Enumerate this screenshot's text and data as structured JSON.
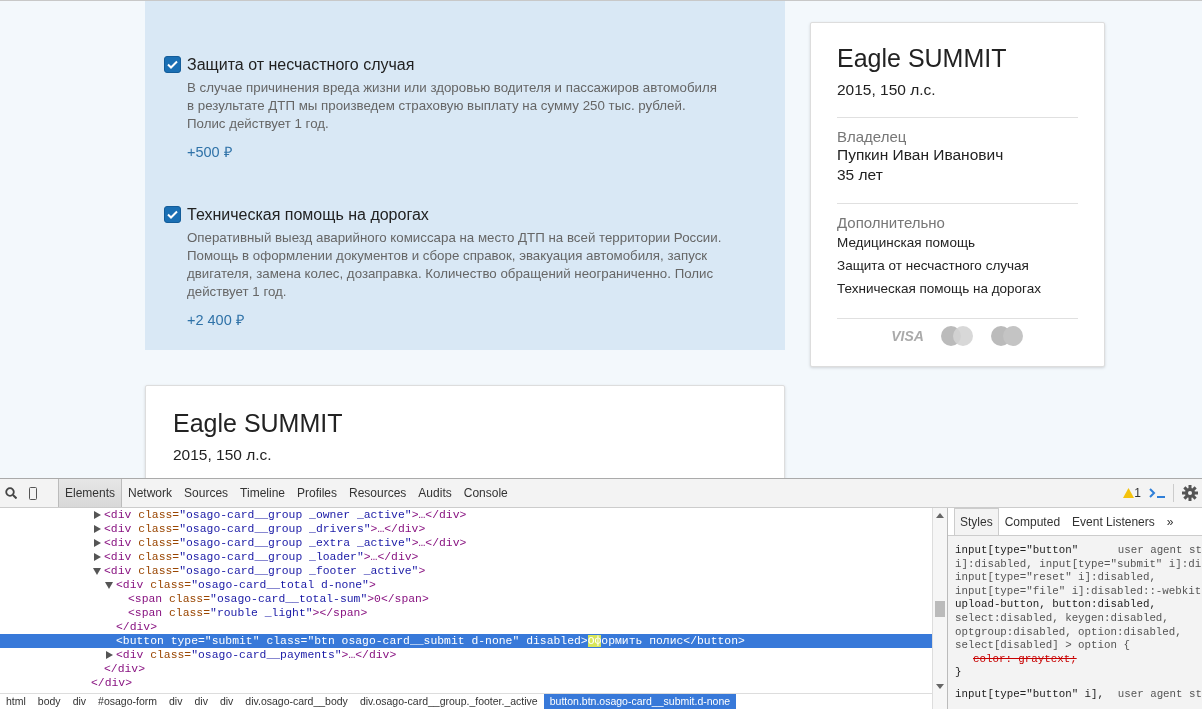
{
  "options": [
    {
      "checked": true,
      "title": "Защита от несчастного случая",
      "description": "В случае причинения вреда жизни или здоровью водителя и пассажиров автомобиля в результате ДТП мы произведем страховую выплату на сумму 250 тыс. рублей. Полис действует 1 год.",
      "price": "+500 ₽"
    },
    {
      "checked": true,
      "title": "Техническая помощь на дорогах",
      "description": "Оперативный выезд аварийного комиссара на место ДТП на всей территории России. Помощь в оформлении документов и сборе справок, эвакуация автомобиля, запуск двигателя, замена колес, дозаправка. Количество обращений неограниченно. Полис действует 1 год.",
      "price": "+2 400 ₽"
    }
  ],
  "summary_card": {
    "title": "Eagle SUMMIT",
    "subtitle": "2015, 150 л.с.",
    "owner_label": "Владелец",
    "owner_name": "Пупкин Иван Иванович",
    "owner_age": "35 лет",
    "extras_label": "Дополнительно",
    "extras": [
      "Медицинская помощь",
      "Защита от несчастного случая",
      "Техническая помощь на дорогах"
    ],
    "payment_visa": "VISA"
  },
  "second_card": {
    "title": "Eagle SUMMIT",
    "subtitle": "2015, 150 л.с."
  },
  "devtools": {
    "tabs": [
      {
        "label": "Elements",
        "selected": true
      },
      {
        "label": "Network",
        "selected": false
      },
      {
        "label": "Sources",
        "selected": false
      },
      {
        "label": "Timeline",
        "selected": false
      },
      {
        "label": "Profiles",
        "selected": false
      },
      {
        "label": "Resources",
        "selected": false
      },
      {
        "label": "Audits",
        "selected": false
      },
      {
        "label": "Console",
        "selected": false
      }
    ],
    "warning_count": "1",
    "tree": [
      {
        "tag": "<div class=\"osago-card__group _owner _active\">…</div>",
        "expanded": false,
        "selected": false
      },
      {
        "tag": "<div class=\"osago-card__group _drivers\">…</div>",
        "expanded": false,
        "selected": false
      },
      {
        "tag": "<div class=\"osago-card__group _extra _active\">…</div>",
        "expanded": false,
        "selected": false
      },
      {
        "tag": "<div class=\"osago-card__group _loader\">…</div>",
        "expanded": false,
        "selected": false
      },
      {
        "tag": "<div class=\"osago-card__group _footer _active\">",
        "expanded": true,
        "selected": false,
        "closing": "</div>",
        "children": [
          {
            "tag": "<div class=\"osago-card__total d-none\">",
            "expanded": true,
            "selected": false,
            "closing": "</div>",
            "children": [
              {
                "tag": "<span class=\"osago-card__total-sum\">0</span>",
                "selected": false
              },
              {
                "tag": "<span class=\"rouble  _light\"></span>",
                "selected": false
              }
            ]
          },
          {
            "tag": "<button type=\"submit\" class=\"btn osago-card__submit d-none\" disabled>",
            "match": "Оф",
            "tag_rest": "ормить полис</button>",
            "selected": true
          },
          {
            "tag": "<div class=\"osago-card__payments\">…</div>",
            "expanded": false,
            "selected": false
          }
        ]
      }
    ],
    "outer_closing": "</div>",
    "breadcrumbs": [
      {
        "label": "html",
        "selected": false
      },
      {
        "label": "body",
        "selected": false
      },
      {
        "label": "div",
        "selected": false
      },
      {
        "label": "#osago-form",
        "selected": false
      },
      {
        "label": "div",
        "selected": false
      },
      {
        "label": "div",
        "selected": false
      },
      {
        "label": "div",
        "selected": false
      },
      {
        "label": "div.osago-card__body",
        "selected": false
      },
      {
        "label": "div.osago-card__group._footer._active",
        "selected": false
      },
      {
        "label": "button.btn.osago-card__submit.d-none",
        "selected": true
      }
    ],
    "side_tabs": [
      {
        "label": "Styles",
        "selected": true
      },
      {
        "label": "Computed",
        "selected": false
      },
      {
        "label": "Event Listeners",
        "selected": false
      }
    ],
    "side_more": "»",
    "rules": [
      {
        "selector": [
          "input[type=\"button\"",
          "i]:disabled, input[type=\"submit\" i]:di",
          "input[type=\"reset\" i]:disabled,",
          "input[type=\"file\" i]:disabled::-webkit",
          "upload-button, button:disabled,",
          "select:disabled, keygen:disabled,",
          "optgroup:disabled, option:disabled,",
          "select[disabled] > option {"
        ],
        "source": "user agent st",
        "properties": [
          {
            "text": "color: graytext;",
            "overridden": true
          }
        ],
        "close": "}"
      },
      {
        "selector": [
          "input[type=\"button\" i],"
        ],
        "source": "user agent st"
      }
    ]
  }
}
